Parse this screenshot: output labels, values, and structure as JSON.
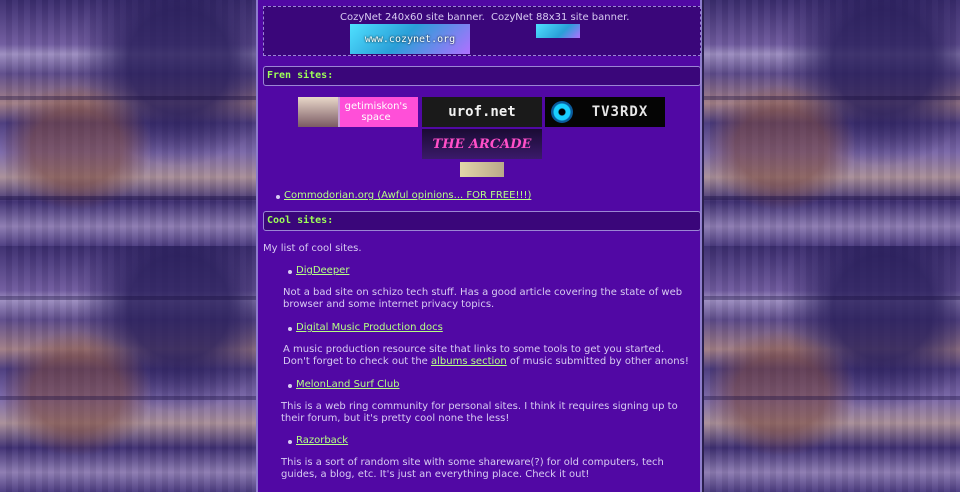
{
  "banners": {
    "big_caption": "CozyNet 240x60 site banner.",
    "small_caption": "CozyNet 88x31 site banner.",
    "big_text": "www.cozynet.org"
  },
  "fren_section": {
    "heading": "Fren sites:",
    "banners": [
      {
        "name": "getimiskon's space",
        "text": "getimiskon's space"
      },
      {
        "name": "urof.net",
        "text": "urof.net"
      },
      {
        "name": "TV3RDX",
        "text": "TV3RDX"
      },
      {
        "name": "The Arcade",
        "text": "THE ARCADE"
      }
    ],
    "links": [
      {
        "label": "Commodorian.org (Awful opinions... FOR FREE!!!)"
      }
    ]
  },
  "cool_section": {
    "heading": "Cool sites:",
    "intro": "My list of cool sites.",
    "sites": [
      {
        "label": "DigDeeper",
        "desc": "Not a bad site on schizo tech stuff. Has a good article covering the state of web browser and some internet privacy topics."
      },
      {
        "label": "Digital Music Production docs",
        "desc_before": "A music production resource site that links to some tools to get you started. Don't forget to check out the ",
        "desc_link": "albums section",
        "desc_after": " of music submitted by other anons!"
      },
      {
        "label": "MelonLand Surf Club",
        "desc": "This is a web ring community for personal sites. I think it requires signing up to their forum, but it's pretty cool none the less!"
      },
      {
        "label": "Razorback",
        "desc": "This is a sort of random site with some shareware(?) for old computers, tech guides, a blog, etc. It's just an everything place. Check it out!"
      }
    ]
  }
}
